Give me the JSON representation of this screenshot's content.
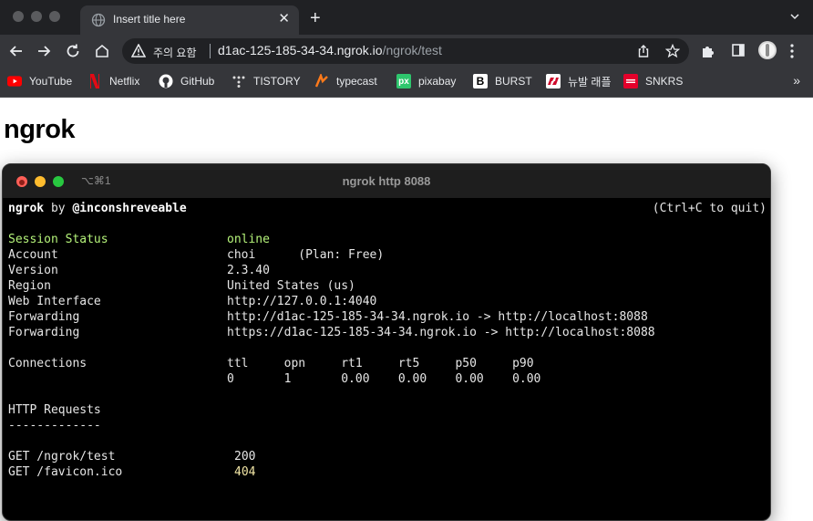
{
  "tab": {
    "title": "Insert title here",
    "close": "✕",
    "new_tab": "+"
  },
  "omnibox": {
    "warning": "주의 요함",
    "url_host": "d1ac-125-185-34-34.ngrok.io",
    "url_path": "/ngrok/test"
  },
  "bookmarks": [
    {
      "label": "YouTube",
      "icon": "youtube-icon",
      "color": "#ff0000"
    },
    {
      "label": "Netflix",
      "icon": "netflix-icon",
      "color": "#e50914"
    },
    {
      "label": "GitHub",
      "icon": "github-icon",
      "color": "#ffffff"
    },
    {
      "label": "TISTORY",
      "icon": "tistory-icon",
      "color": "#ffffff"
    },
    {
      "label": "typecast",
      "icon": "typecast-icon",
      "color": "#ff7a1a"
    },
    {
      "label": "pixabay",
      "icon": "pixabay-icon",
      "color": "#2ec66d"
    },
    {
      "label": "BURST",
      "icon": "burst-icon",
      "color": "#ffffff"
    },
    {
      "label": "뉴발 래플",
      "icon": "newbalance-icon",
      "color": "#cf0a2c"
    },
    {
      "label": "SNKRS",
      "icon": "snkrs-icon",
      "color": "#e4002b"
    }
  ],
  "page": {
    "heading": "ngrok"
  },
  "terminal": {
    "keys": "⌥⌘1",
    "title": "ngrok http 8088",
    "header_left_brand": "ngrok",
    "header_left_by": " by ",
    "header_left_author": "@inconshreveable",
    "header_right": "(Ctrl+C to quit)",
    "session_label": "Session Status",
    "session_value": "online",
    "info": [
      {
        "label": "Account",
        "value": "choi      (Plan: Free)"
      },
      {
        "label": "Version",
        "value": "2.3.40"
      },
      {
        "label": "Region",
        "value": "United States (us)"
      },
      {
        "label": "Web Interface",
        "value": "http://127.0.0.1:4040"
      },
      {
        "label": "Forwarding",
        "value": "http://d1ac-125-185-34-34.ngrok.io -> http://localhost:8088"
      },
      {
        "label": "Forwarding",
        "value": "https://d1ac-125-185-34-34.ngrok.io -> http://localhost:8088"
      }
    ],
    "connections_label": "Connections",
    "connections_headers": "ttl     opn     rt1     rt5     p50     p90",
    "connections_values": "0       1       0.00    0.00    0.00    0.00",
    "http_label": "HTTP Requests",
    "http_rule": "-------------",
    "requests": [
      {
        "path": "GET /ngrok/test",
        "status": "200"
      },
      {
        "path": "GET /favicon.ico",
        "status": "404"
      }
    ]
  },
  "colors": {
    "online": "#b5f37a",
    "status_404": "#f2e6a6",
    "close_light": "#ff5f57",
    "min_light": "#febc2e",
    "max_light": "#28c840"
  }
}
